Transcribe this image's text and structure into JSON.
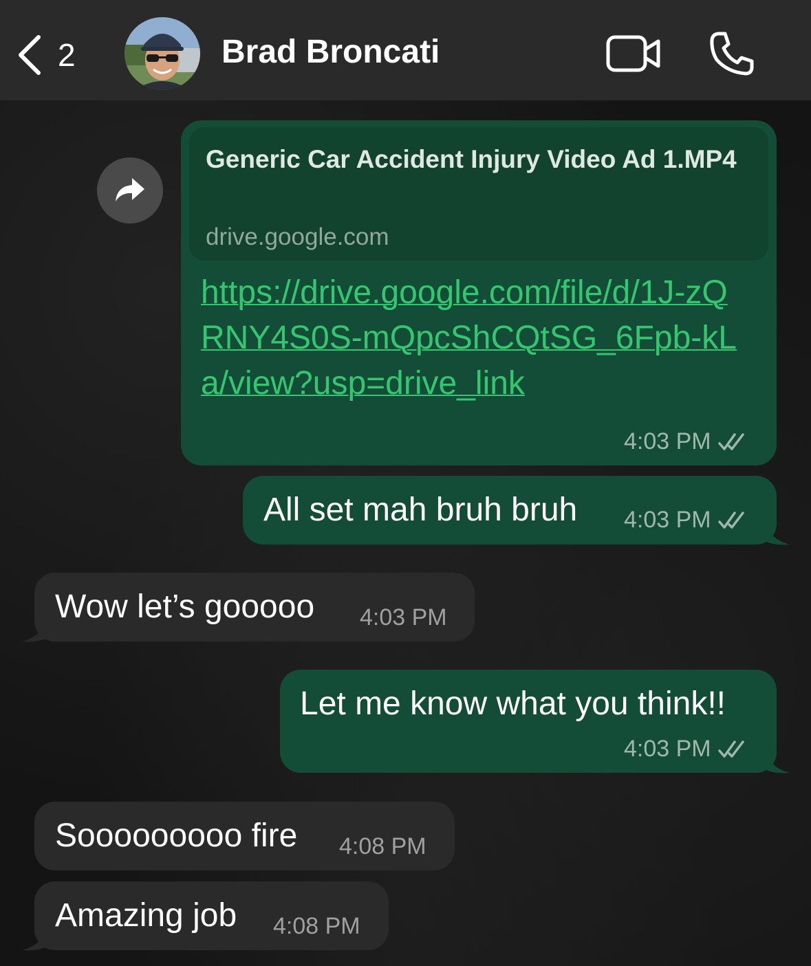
{
  "header": {
    "back_count": "2",
    "contact_name": "Brad Broncati"
  },
  "messages": {
    "m1": {
      "preview_title": "Generic Car Accident Injury Video Ad 1.MP4",
      "preview_domain": "drive.google.com",
      "link": "https://drive.google.com/file/d/1J-zQRNY4S0S-mQpcShCQtSG_6Fpb-kLa/view?usp=drive_link",
      "time": "4:03 PM"
    },
    "m2": {
      "text": "All set mah bruh bruh",
      "time": "4:03 PM"
    },
    "m3": {
      "text": "Wow let’s gooooo",
      "time": "4:03 PM"
    },
    "m4": {
      "text": "Let me know what you think!!",
      "time": "4:03 PM"
    },
    "m5": {
      "text": "Sooooooooo fire",
      "time": "4:08 PM"
    },
    "m6": {
      "text": "Amazing job",
      "time": "4:08 PM"
    }
  },
  "icons": {
    "back": "chevron-left-icon",
    "video": "video-camera-icon",
    "call": "phone-icon",
    "forward": "forward-arrow-icon",
    "read": "double-check-icon"
  },
  "colors": {
    "outgoing_bubble": "#144d37",
    "incoming_bubble": "#2a2a2a",
    "link": "#35c770",
    "header": "#2a2a2a"
  }
}
